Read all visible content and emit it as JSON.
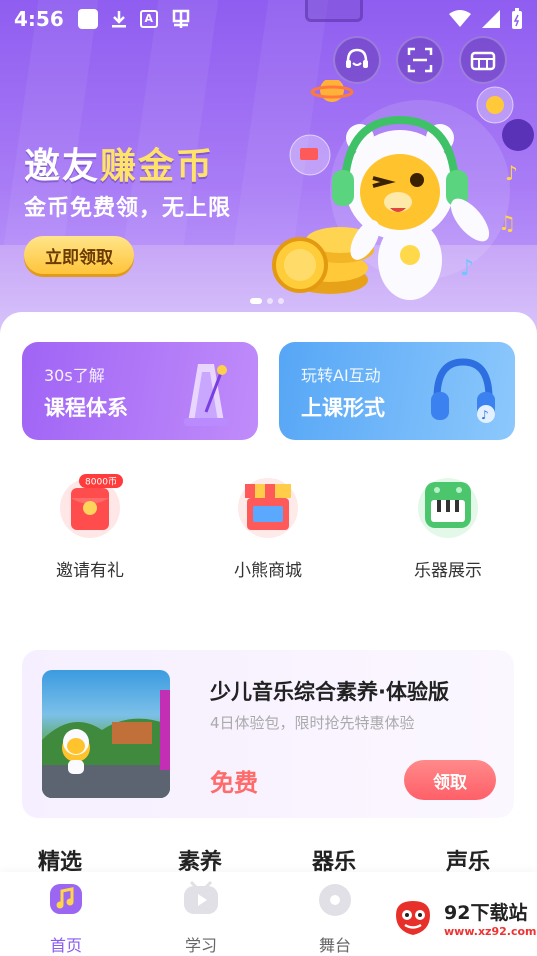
{
  "status_bar": {
    "time": "4:56",
    "a_icon_letter": "A"
  },
  "banner": {
    "title_part1": "邀友",
    "title_gold": "赚金币",
    "subtitle": "金币免费领，无上限",
    "claim_label": "立即领取"
  },
  "features": [
    {
      "small": "30s了解",
      "big": "课程体系"
    },
    {
      "small": "玩转AI互动",
      "big": "上课形式"
    }
  ],
  "quick_links": [
    {
      "label": "邀请有礼",
      "badge": "8000币"
    },
    {
      "label": "小熊商城"
    },
    {
      "label": "乐器展示"
    }
  ],
  "course": {
    "title": "少儿音乐综合素养·体验版",
    "desc": "4日体验包，限时抢先特惠体验",
    "price": "免费",
    "btn": "领取"
  },
  "categories": [
    "精选",
    "素养",
    "器乐",
    "声乐"
  ],
  "bottom_nav": [
    {
      "label": "首页"
    },
    {
      "label": "学习"
    },
    {
      "label": "舞台"
    }
  ],
  "watermark": {
    "big": "92下载站",
    "small": "www.xz92.com"
  },
  "colors": {
    "accent": "#8b5cf0",
    "price": "#ff6a6a",
    "gold": "#ffe26a"
  }
}
